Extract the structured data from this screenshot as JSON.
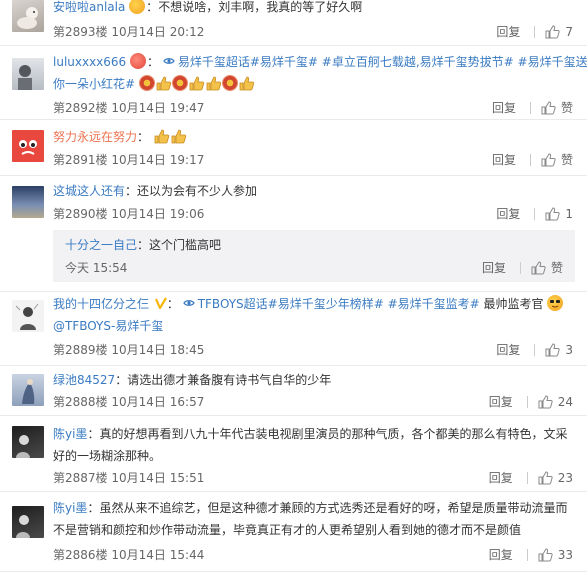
{
  "ui": {
    "reply_label": "回复",
    "like_label": "赞"
  },
  "comments": [
    {
      "user": "安啦啦anlala",
      "sep": "：",
      "text": "不想说啥，刘丰啊，我真的等了好久啊",
      "floor": "第2893楼",
      "date": "10月14日",
      "time": "20:12",
      "likes": "7"
    },
    {
      "user": "luluxxxx666",
      "sep": "：",
      "topics": "易烊千玺超话#易烊千玺# #卓立百舸七载越,易烊千玺势拔节# #易烊千玺送",
      "line2": "你一朵小红花#",
      "floor": "第2892楼",
      "date": "10月14日",
      "time": "19:47",
      "likes": "赞"
    },
    {
      "user": "努力永远在努力",
      "sep": "：",
      "floor": "第2891楼",
      "date": "10月14日",
      "time": "19:17",
      "likes": "赞"
    },
    {
      "user": "这城这人还有",
      "sep": "：",
      "text": "还以为会有不少人参加",
      "floor": "第2890楼",
      "date": "10月14日",
      "time": "19:06",
      "likes": "1"
    },
    {
      "user": "十分之一自己",
      "sep": "：",
      "text": "这个门槛高吧",
      "time": "今天 15:54",
      "likes": "赞"
    },
    {
      "user": "我的十四亿分之仨",
      "sep": "：",
      "topics": "TFBOYS超话#易烊千玺少年榜样# #易烊千玺监考# ",
      "text": "最帅监考官",
      "line2": "@TFBOYS-易烊千玺",
      "floor": "第2889楼",
      "date": "10月14日",
      "time": "18:45",
      "likes": "3"
    },
    {
      "user": "绿池84527",
      "sep": "：",
      "text": "请选出德才兼备腹有诗书气自华的少年",
      "floor": "第2888楼",
      "date": "10月14日",
      "time": "16:57",
      "likes": "24"
    },
    {
      "user": "陈yi墨",
      "sep": "：",
      "text": "真的好想再看到八九十年代古装电视剧里演员的那种气质，各个都美的那么有特色，文采",
      "line2": "好的一场糊涂那种。",
      "floor": "第2887楼",
      "date": "10月14日",
      "time": "15:51",
      "likes": "23"
    },
    {
      "user": "陈yi墨",
      "sep": "：",
      "text": "虽然从来不追综艺，但是这种德才兼顾的方式选秀还是看好的呀，希望是质量带动流量而",
      "line2": "不是营销和颜控和炒作带动流量，毕竟真正有才的人更希望别人看到她的德才而不是颜值",
      "floor": "第2886楼",
      "date": "10月14日",
      "time": "15:44",
      "likes": "33"
    }
  ]
}
